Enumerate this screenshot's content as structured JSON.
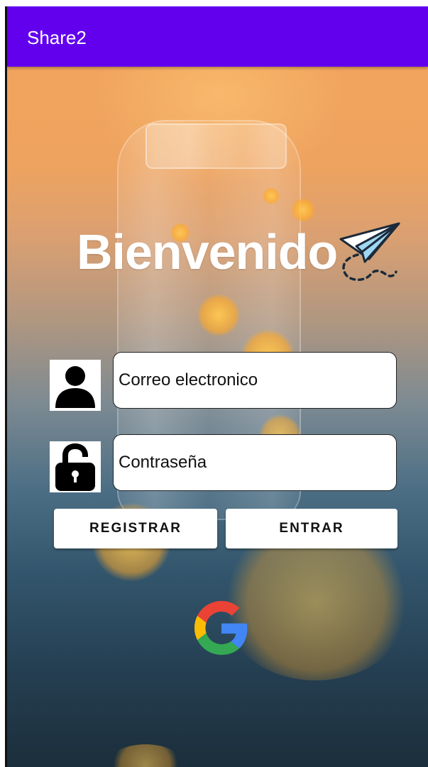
{
  "app": {
    "title": "Share2"
  },
  "welcome": {
    "text": "Bienvenido"
  },
  "form": {
    "email_placeholder": "Correo electronico",
    "email_value": "",
    "password_placeholder": "Contraseña",
    "password_value": ""
  },
  "buttons": {
    "register_label": "REGISTRAR",
    "enter_label": "ENTRAR"
  },
  "icons": {
    "user": "user-icon",
    "lock": "unlocked-padlock-icon",
    "paper_plane": "paper-plane-icon",
    "google": "google-icon"
  },
  "colors": {
    "app_bar": "#6200ee",
    "google_blue": "#4285F4",
    "google_red": "#EA4335",
    "google_yellow": "#FBBC05",
    "google_green": "#34A853"
  }
}
